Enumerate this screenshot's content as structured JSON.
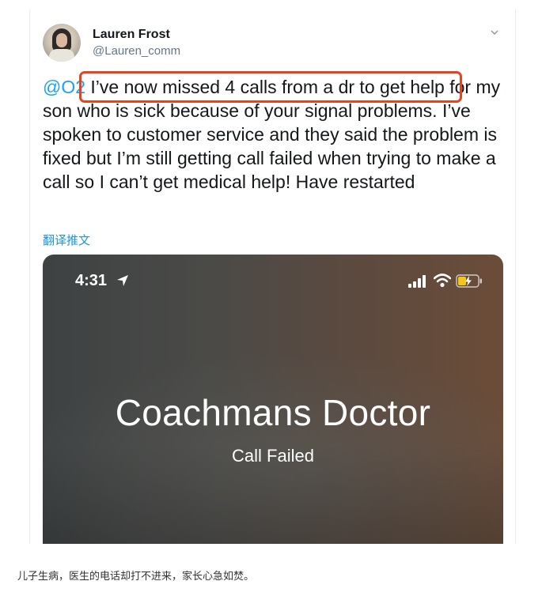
{
  "tweet": {
    "author_name": "Lauren Frost",
    "author_handle": "@Lauren_comm",
    "mention": "@O2",
    "body": " I’ve now missed 4 calls from a dr to get help for my son who is sick because of your signal problems. I’ve spoken to customer service and they said the problem is fixed but I’m still getting call failed when trying to make a call so I can’t get medical help! Have restarted",
    "translate_label": "翻译推文",
    "highlight_color": "#e8431f",
    "link_color": "#1da1f2"
  },
  "phone_screenshot": {
    "time": "4:31",
    "contact_name": "Coachmans Doctor",
    "call_status": "Call Failed",
    "icons": [
      "location-arrow-icon",
      "signal-bars-icon",
      "wifi-icon",
      "battery-charging-icon"
    ]
  },
  "caption": "儿子生病，医生的电话却打不进来，家长心急如焚。"
}
